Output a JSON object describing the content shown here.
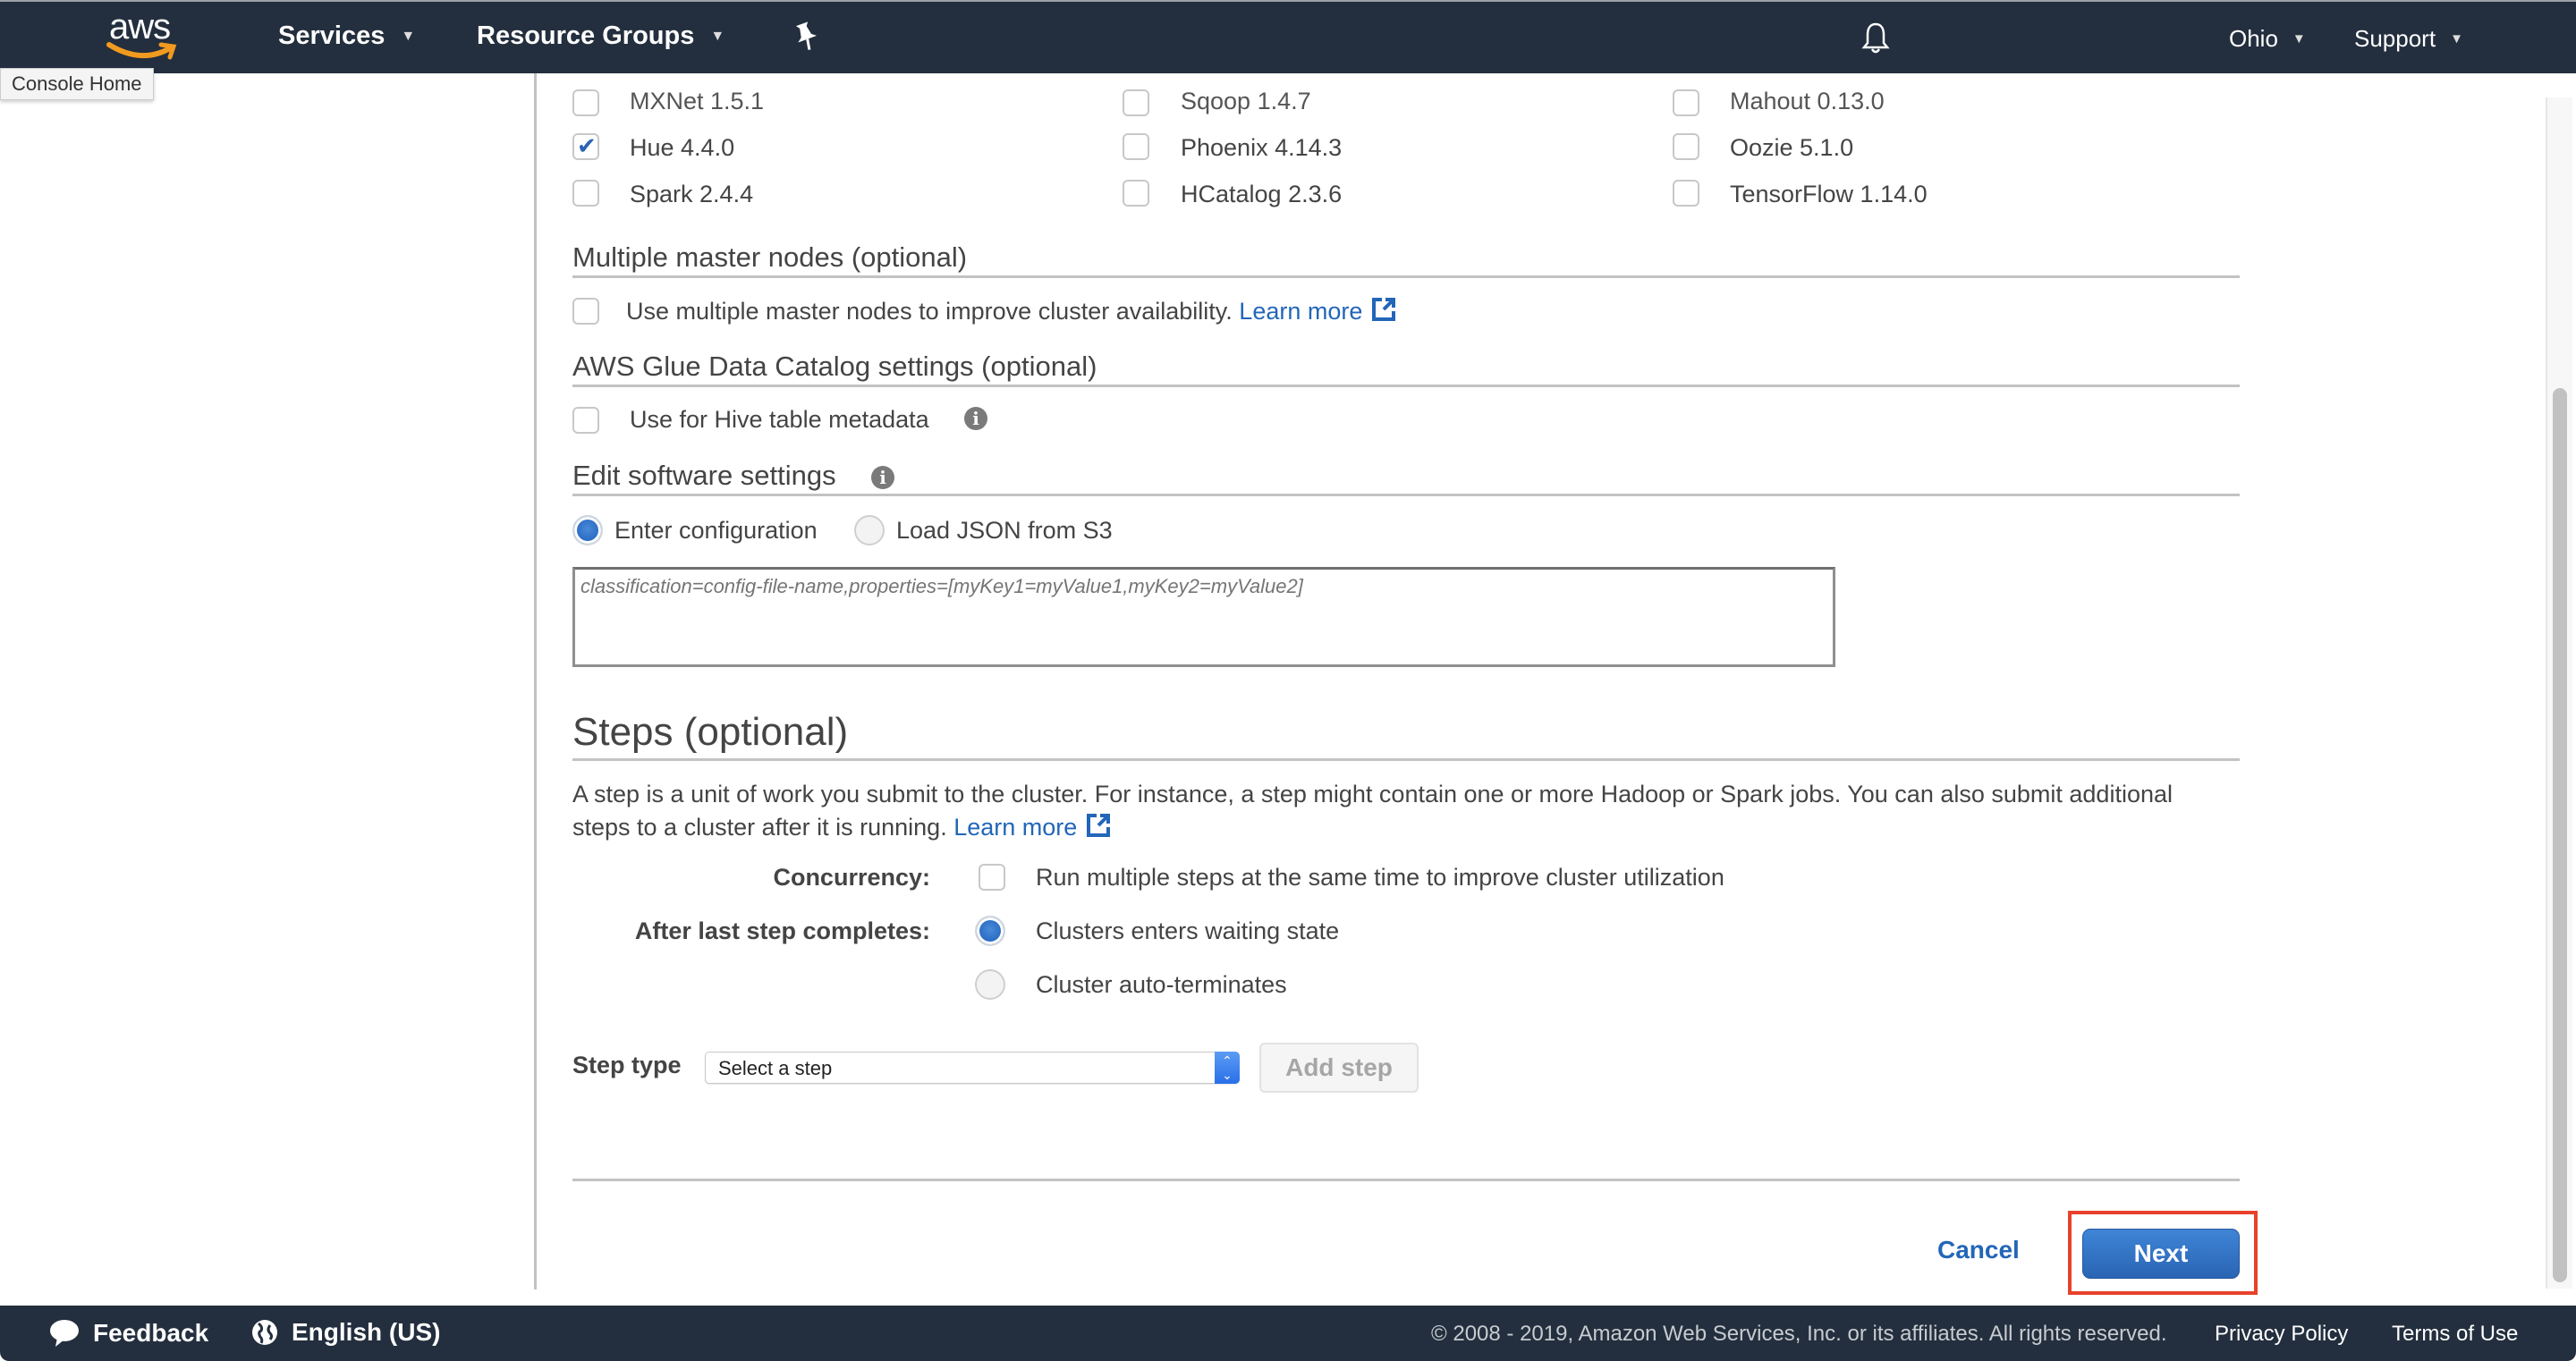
{
  "header": {
    "logo_text": "aws",
    "nav": [
      {
        "label": "Services"
      },
      {
        "label": "Resource Groups"
      }
    ],
    "region": "Ohio",
    "support": "Support",
    "tooltip": "Console Home"
  },
  "applications": {
    "rows": [
      [
        {
          "label": "MXNet 1.5.1",
          "checked": false
        },
        {
          "label": "Sqoop 1.4.7",
          "checked": false
        },
        {
          "label": "Mahout 0.13.0",
          "checked": false
        }
      ],
      [
        {
          "label": "Hue 4.4.0",
          "checked": true
        },
        {
          "label": "Phoenix 4.14.3",
          "checked": false
        },
        {
          "label": "Oozie 5.1.0",
          "checked": false
        }
      ],
      [
        {
          "label": "Spark 2.4.4",
          "checked": false
        },
        {
          "label": "HCatalog 2.3.6",
          "checked": false
        },
        {
          "label": "TensorFlow 1.14.0",
          "checked": false
        }
      ]
    ]
  },
  "multi_master": {
    "title": "Multiple master nodes (optional)",
    "checkbox_label": "Use multiple master nodes to improve cluster availability.",
    "checked": false,
    "learn_more": "Learn more"
  },
  "glue": {
    "title": "AWS Glue Data Catalog settings (optional)",
    "checkbox_label": "Use for Hive table metadata",
    "checked": false
  },
  "software_settings": {
    "title": "Edit software settings",
    "options": [
      {
        "label": "Enter configuration",
        "selected": true
      },
      {
        "label": "Load JSON from S3",
        "selected": false
      }
    ],
    "placeholder": "classification=config-file-name,properties=[myKey1=myValue1,myKey2=myValue2]",
    "value": ""
  },
  "steps": {
    "title": "Steps (optional)",
    "description": "A step is a unit of work you submit to the cluster. For instance, a step might contain one or more Hadoop or Spark jobs. You can also submit additional steps to a cluster after it is running.",
    "learn_more": "Learn more",
    "concurrency_label": "Concurrency:",
    "concurrency_option": "Run multiple steps at the same time to improve cluster utilization",
    "concurrency_checked": false,
    "after_last_label": "After last step completes:",
    "after_last_options": [
      {
        "label": "Clusters enters waiting state",
        "selected": true
      },
      {
        "label": "Cluster auto-terminates",
        "selected": false
      }
    ],
    "step_type_label": "Step type",
    "step_type_value": "Select a step",
    "add_step": "Add step"
  },
  "actions": {
    "cancel": "Cancel",
    "next": "Next",
    "highlight_color": "#e8412b"
  },
  "footer": {
    "feedback": "Feedback",
    "language": "English (US)",
    "copyright": "© 2008 - 2019, Amazon Web Services, Inc. or its affiliates. All rights reserved.",
    "privacy": "Privacy Policy",
    "terms": "Terms of Use"
  },
  "colors": {
    "header_bg": "#232f3e",
    "link": "#2266b8",
    "primary_button": "#2a64b4",
    "aws_orange": "#f29a1f"
  }
}
